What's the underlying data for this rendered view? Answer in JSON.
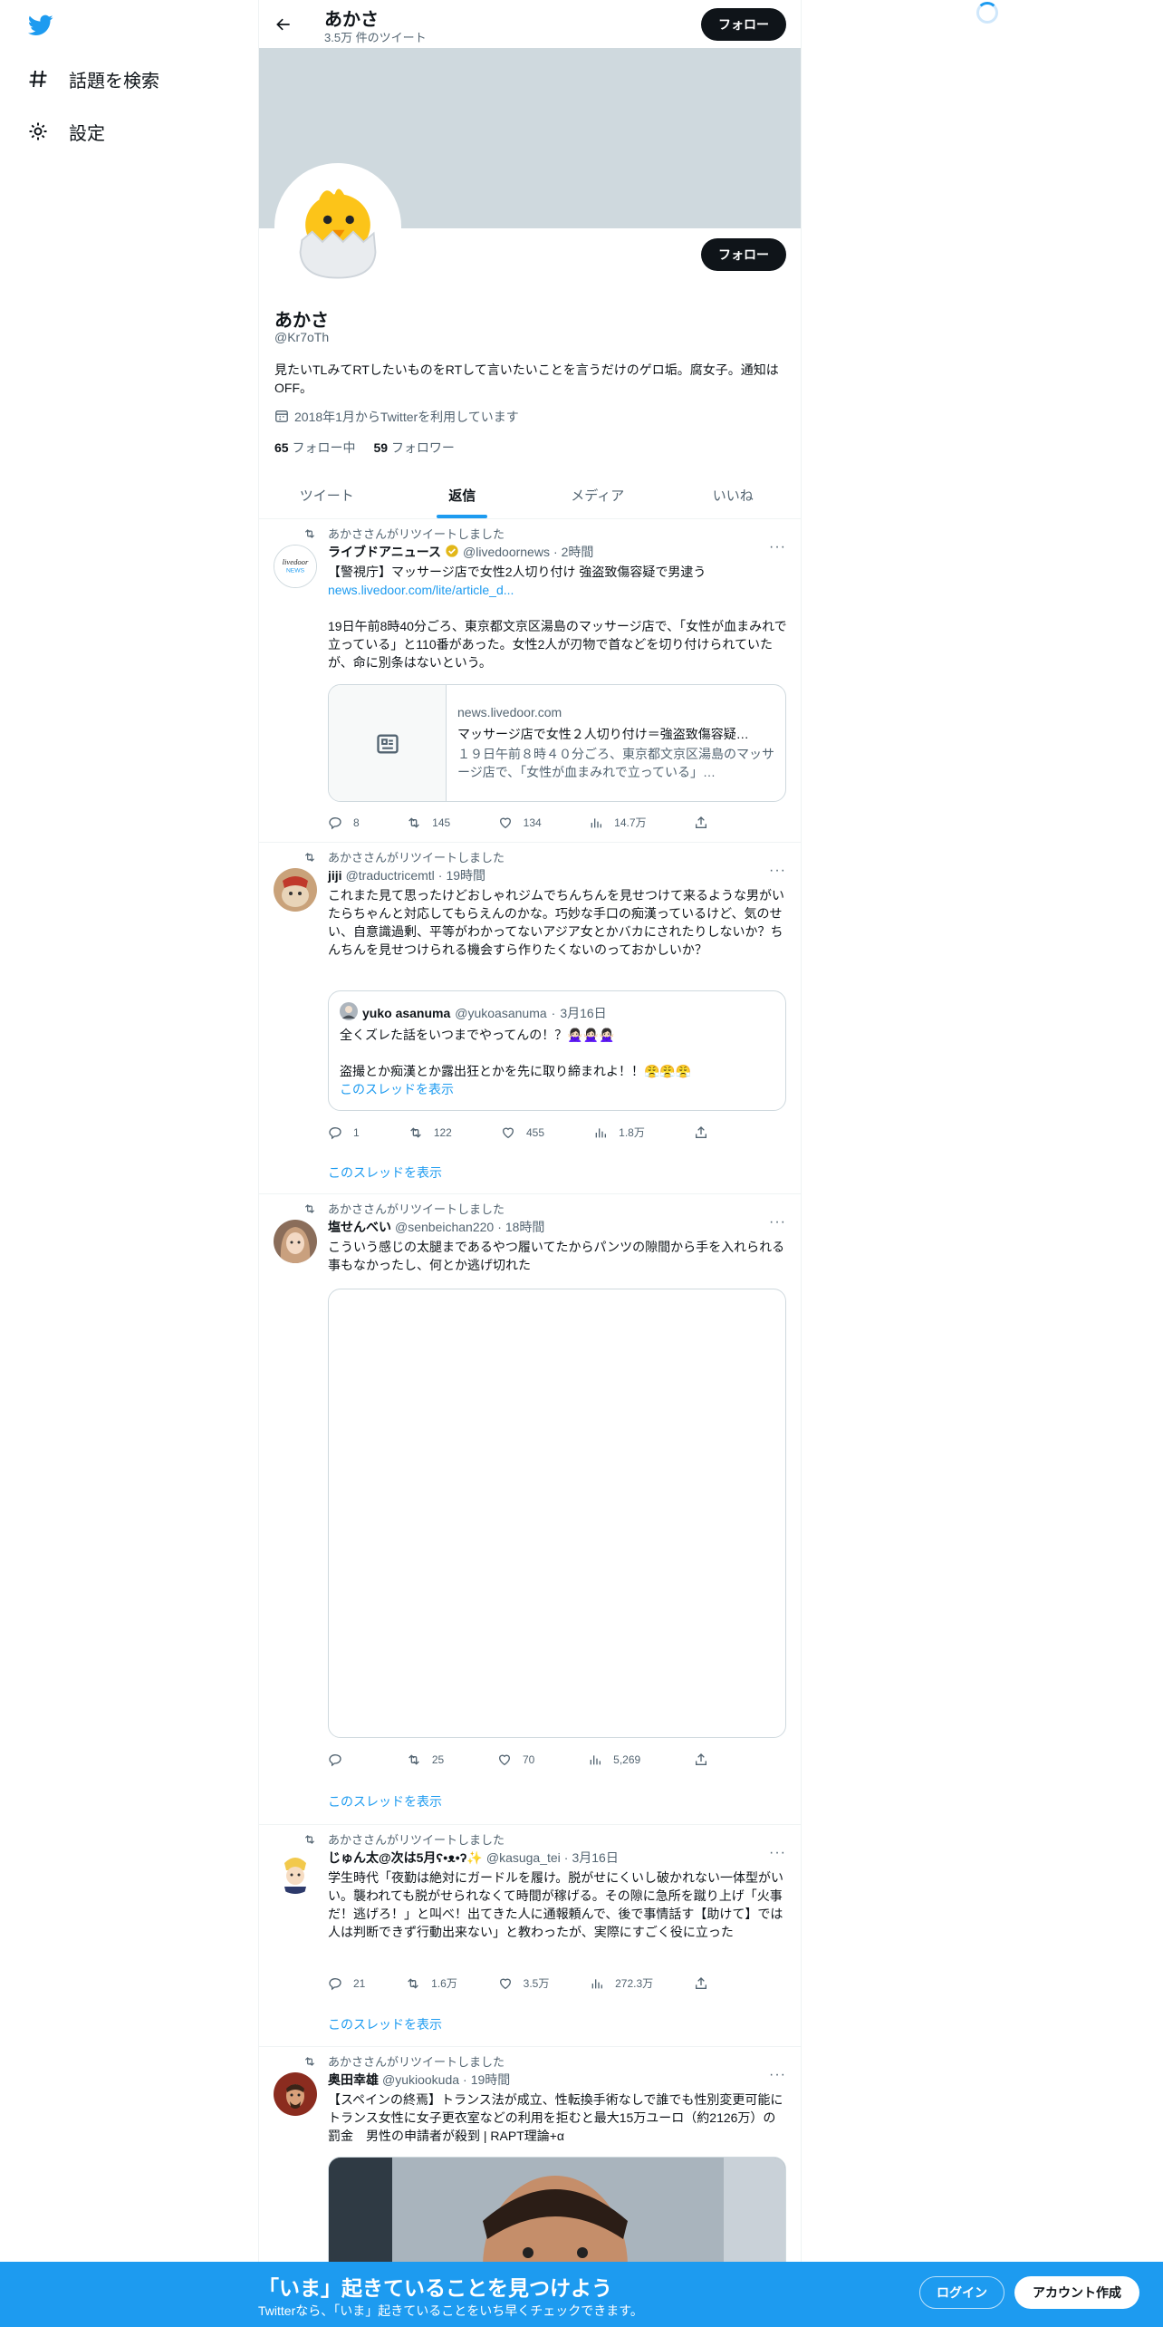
{
  "sidebar": {
    "items": [
      {
        "label": "話題を検索",
        "icon": "hashtag-icon"
      },
      {
        "label": "設定",
        "icon": "gear-icon"
      }
    ]
  },
  "header": {
    "name": "あかさ",
    "tweet_count": "3.5万 件のツイート",
    "follow_label": "フォロー"
  },
  "profile": {
    "name": "あかさ",
    "handle": "@Kr7oTh",
    "bio": "見たいTLみてRTしたいものをRTして言いたいことを言うだけのゲロ垢。腐女子。通知はOFF。",
    "joined": "2018年1月からTwitterを利用しています",
    "following_count": "65",
    "following_label": "フォロー中",
    "followers_count": "59",
    "followers_label": "フォロワー",
    "follow_label": "フォロー"
  },
  "tabs": [
    {
      "label": "ツイート",
      "active": false
    },
    {
      "label": "返信",
      "active": true
    },
    {
      "label": "メディア",
      "active": false
    },
    {
      "label": "いいね",
      "active": false
    }
  ],
  "retweet_label": "あかささんがリツイートしました",
  "show_thread": "このスレッドを表示",
  "tweets": [
    {
      "name": "ライブドアニュース",
      "handle": "@livedoornews",
      "time": "2時間",
      "text1": "【警視庁】マッサージ店で女性2人切り付け 強盗致傷容疑で男逮う",
      "link": "news.livedoor.com/lite/article_d...",
      "text2": "19日午前8時40分ごろ、東京都文京区湯島のマッサージ店で、「女性が血まみれで立っている」と110番があった。女性2人が刃物で首などを切り付けられていたが、命に別条はないという。",
      "card_domain": "news.livedoor.com",
      "card_title": "マッサージ店で女性２人切り付け＝強盗致傷容疑…",
      "card_desc": "１９日午前８時４０分ごろ、東京都文京区湯島のマッサージ店で、「女性が血まみれで立っている」…",
      "replies": "8",
      "retweets": "145",
      "likes": "134",
      "views": "14.7万"
    },
    {
      "name": "jiji",
      "handle": "@traductricemtl",
      "time": "19時間",
      "text": "これまた見て思ったけどおしゃれジムでちんちんを見せつけて来るような男がいたらちゃんと対応してもらえんのかな。巧妙な手口の痴漢っているけど、気のせい、自意識過剰、平等がわかってないアジア女とかバカにされたりしないか？ちんちんを見せつけられる機会すら作りたくないのっておかしいか？",
      "quote_name": "yuko asanuma",
      "quote_handle": "@yukoasanuma",
      "quote_time": "3月16日",
      "quote_text1": "全くズレた話をいつまでやってんの！？🙅🏻‍♀️🙅🏻‍♀️🙅🏻‍♀️",
      "quote_text2": "盗撮とか痴漢とか露出狂とかを先に取り締まれよ！！😤😤😤",
      "replies": "1",
      "retweets": "122",
      "likes": "455",
      "views": "1.8万"
    },
    {
      "name": "塩せんべい",
      "handle": "@senbeichan220",
      "time": "18時間",
      "text": "こういう感じの太腿まであるやつ履いてたからパンツの隙間から手を入れられる事もなかったし、何とか逃げ切れた",
      "replies": "",
      "retweets": "25",
      "likes": "70",
      "views": "5,269"
    },
    {
      "name": "じゅん太@次は5月ʕ•ᴥ•ʔ✨",
      "handle": "@kasuga_tei",
      "time": "3月16日",
      "text": "学生時代「夜勤は絶対にガードルを履け。脱がせにくいし破かれない一体型がいい。襲われても脱がせられなくて時間が稼げる。その隙に急所を蹴り上げ「火事だ！逃げろ！」と叫べ！出てきた人に通報頼んで、後で事情話す【助けて】では人は判断できず行動出来ない」と教わったが、実際にすごく役に立った",
      "replies": "21",
      "retweets": "1.6万",
      "likes": "3.5万",
      "views": "272.3万"
    },
    {
      "name": "奥田幸雄",
      "handle": "@yukiookuda",
      "time": "19時間",
      "text": "【スペインの終焉】トランス法が成立、性転換手術なしで誰でも性別変更可能に　トランス女性に女子更衣室などの利用を拒むと最大15万ユーロ（約2126万）の罰金　男性の申請者が殺到 | RAPT理論+α"
    }
  ],
  "bottom_bar": {
    "title": "「いま」起きていることを見つけよう",
    "subtitle": "Twitterなら、「いま」起きていることをいち早くチェックできます。",
    "login": "ログイン",
    "signup": "アカウント作成"
  },
  "colors": {
    "accent": "#1d9bf0",
    "text": "#0f1419",
    "muted": "#536471",
    "banner": "#cfd9de"
  }
}
